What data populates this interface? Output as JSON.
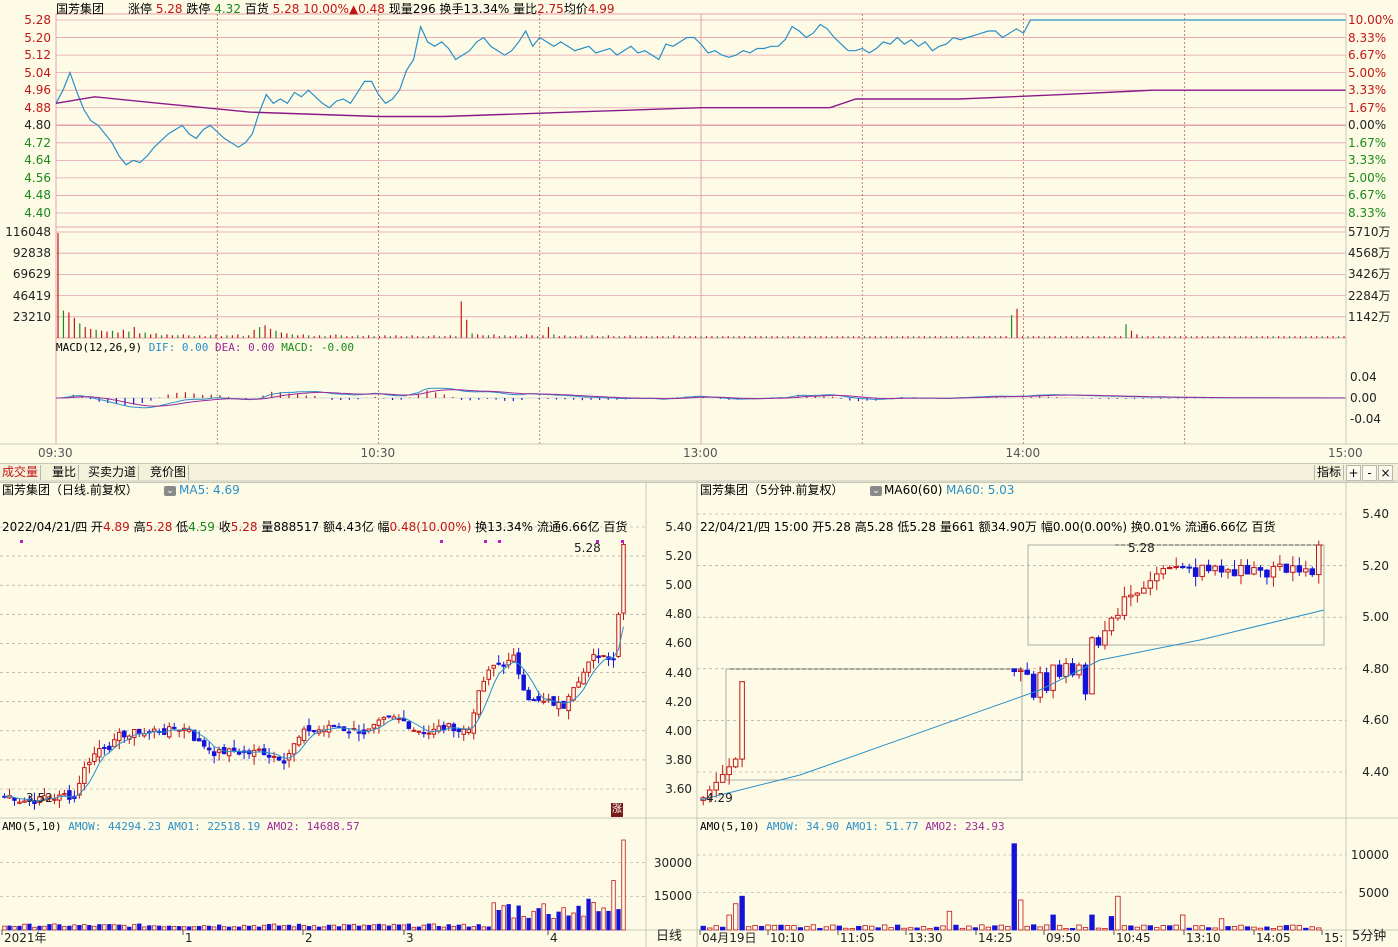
{
  "colors": {
    "up": "#c21515",
    "down": "#1414d8",
    "price_line": "#2a8fc8",
    "avg_line": "#8a1a8a",
    "dif": "#2a8fc8",
    "dea": "#9a2a9a",
    "grid": "#e6a0b0",
    "flat": "#222222",
    "neg": "#1a8a1a"
  },
  "intraday": {
    "header": {
      "name": "国芳集团",
      "limit_up_label": "涨停",
      "limit_up": "5.28",
      "limit_down_label": "跌停",
      "limit_down": "4.32",
      "pct_label": "百货",
      "price": "5.28",
      "pct": "10.00%",
      "change_arrow": "▲",
      "change": "0.48",
      "vol_now_label": "现量",
      "vol_now": "296",
      "turnover_label": "换手",
      "turnover": "13.34%",
      "vol_ratio_label": "量比",
      "vol_ratio": "2.75",
      "avg_label": "均价",
      "avg": "4.99"
    },
    "price_ticks": [
      "5.28",
      "5.20",
      "5.12",
      "5.04",
      "4.96",
      "4.88",
      "4.80",
      "4.72",
      "4.64",
      "4.56",
      "4.48",
      "4.40"
    ],
    "pct_ticks": [
      "10.00%",
      "8.33%",
      "6.67%",
      "5.00%",
      "3.33%",
      "1.67%",
      "0.00%",
      "1.67%",
      "3.33%",
      "5.00%",
      "6.67%",
      "8.33%"
    ],
    "vol_ticks_left": [
      "116048",
      "92838",
      "69629",
      "46419",
      "23210"
    ],
    "vol_ticks_right": [
      "5710万",
      "4568万",
      "3426万",
      "2284万",
      "1142万"
    ],
    "macd_label": "MACD(12,26,9)",
    "dif_label": "DIF: 0.00",
    "dea_label": "DEA: 0.00",
    "macd_val_label": "MACD: -0.00",
    "macd_ticks": [
      "0.04",
      "0.00",
      "-0.04"
    ],
    "time_ticks": [
      "09:30",
      "10:30",
      "13:00",
      "14:00",
      "15:00"
    ],
    "price_series": [
      4.9,
      4.96,
      5.04,
      4.95,
      4.87,
      4.82,
      4.8,
      4.76,
      4.72,
      4.66,
      4.62,
      4.64,
      4.63,
      4.66,
      4.7,
      4.73,
      4.76,
      4.78,
      4.8,
      4.76,
      4.74,
      4.78,
      4.8,
      4.77,
      4.74,
      4.72,
      4.7,
      4.72,
      4.76,
      4.86,
      4.94,
      4.9,
      4.92,
      4.9,
      4.95,
      4.93,
      4.96,
      4.93,
      4.9,
      4.88,
      4.91,
      4.92,
      4.9,
      4.95,
      5.0,
      5.0,
      4.94,
      4.9,
      4.92,
      4.96,
      5.05,
      5.1,
      5.25,
      5.18,
      5.16,
      5.18,
      5.15,
      5.1,
      5.12,
      5.14,
      5.18,
      5.2,
      5.16,
      5.14,
      5.12,
      5.14,
      5.18,
      5.23,
      5.16,
      5.2,
      5.18,
      5.16,
      5.18,
      5.16,
      5.14,
      5.15,
      5.16,
      5.13,
      5.14,
      5.15,
      5.12,
      5.14,
      5.16,
      5.13,
      5.14,
      5.12,
      5.1,
      5.17,
      5.16,
      5.18,
      5.2,
      5.2,
      5.17,
      5.13,
      5.14,
      5.12,
      5.11,
      5.12,
      5.14,
      5.13,
      5.15,
      5.15,
      5.16,
      5.16,
      5.19,
      5.25,
      5.23,
      5.2,
      5.22,
      5.26,
      5.24,
      5.2,
      5.17,
      5.14,
      5.14,
      5.15,
      5.13,
      5.15,
      5.18,
      5.17,
      5.2,
      5.17,
      5.19,
      5.16,
      5.18,
      5.14,
      5.16,
      5.17,
      5.2,
      5.19,
      5.2,
      5.21,
      5.22,
      5.23,
      5.23,
      5.2,
      5.22,
      5.24,
      5.22,
      5.28,
      5.28,
      5.28,
      5.28,
      5.28,
      5.28,
      5.28,
      5.28,
      5.28,
      5.28,
      5.28,
      5.28,
      5.28,
      5.28,
      5.28,
      5.28,
      5.28,
      5.28,
      5.28,
      5.28,
      5.28,
      5.28,
      5.28,
      5.28,
      5.28,
      5.28,
      5.28,
      5.28,
      5.28,
      5.28,
      5.28,
      5.28,
      5.28,
      5.28,
      5.28,
      5.28,
      5.28,
      5.28,
      5.28,
      5.28,
      5.28,
      5.28,
      5.28,
      5.28,
      5.28,
      5.28
    ],
    "avg_series": [
      [
        0,
        4.9
      ],
      [
        0.03,
        4.93
      ],
      [
        0.08,
        4.9
      ],
      [
        0.15,
        4.86
      ],
      [
        0.25,
        4.84
      ],
      [
        0.3,
        4.84
      ],
      [
        0.4,
        4.86
      ],
      [
        0.5,
        4.88
      ],
      [
        0.6,
        4.88
      ],
      [
        0.62,
        4.92
      ],
      [
        0.7,
        4.92
      ],
      [
        0.78,
        4.94
      ],
      [
        0.85,
        4.96
      ],
      [
        0.95,
        4.96
      ],
      [
        1,
        4.96
      ]
    ],
    "volume_bars": [
      115000,
      30000,
      28000,
      22000,
      16000,
      12000,
      10000,
      9000,
      8000,
      7000,
      8000,
      6000,
      9000,
      7000,
      12000,
      5000,
      6000,
      4000,
      5000,
      3000,
      4000,
      3000,
      3000,
      4000,
      3000,
      2000,
      3000,
      2000,
      3000,
      4000,
      2000,
      3000,
      3000,
      4000,
      2000,
      3000,
      9000,
      12000,
      14000,
      10000,
      8000,
      6000,
      5000,
      4000,
      3000,
      4000,
      3000,
      2000,
      3000,
      2000,
      3000,
      4000,
      3000,
      2000,
      2000,
      3000,
      2000,
      3000,
      2000,
      2000,
      3000,
      2000,
      3000,
      2000,
      2000,
      3000,
      2000,
      2000,
      2000,
      3000,
      2000,
      2000,
      3000,
      2000,
      40000,
      20000,
      5000,
      4000,
      3000,
      3000,
      4000,
      2000,
      3000,
      2000,
      3000,
      2000,
      4000,
      3000,
      2000,
      3000,
      12000,
      4000,
      2000,
      3000,
      2000,
      2000,
      3000,
      2000,
      3000,
      2000,
      2000,
      3000,
      2000,
      2000,
      2000,
      3000,
      2000,
      2000,
      2000,
      2000,
      2000,
      2000,
      2000,
      3000,
      2000,
      2000,
      2000,
      2000,
      2000,
      2000,
      2000,
      2000,
      2000,
      2000,
      2000,
      2000,
      2000,
      2000,
      2000,
      2000,
      2000,
      2000,
      2000,
      2000,
      2000,
      2000,
      2000,
      2000,
      2000,
      2000,
      2000,
      2000,
      2000,
      2000,
      2000,
      2000,
      2000,
      2000,
      2000,
      2000,
      2000,
      2000,
      2000,
      2000,
      2000,
      2000,
      2000,
      2000,
      2000,
      2000,
      2000,
      2000,
      2000,
      2000,
      2000,
      2000,
      2000,
      2000,
      2000,
      2000,
      2000,
      2000,
      2000,
      2000,
      2000,
      25000,
      32000,
      2000,
      2000,
      2000,
      2000,
      2000,
      2000,
      2000,
      2000,
      2000,
      2000,
      2000,
      2000,
      2000,
      2000,
      2000,
      2000,
      2000,
      2000,
      2000,
      15000,
      8000,
      4000,
      2000,
      2000,
      2000,
      2000,
      2000,
      2000,
      2000,
      2000,
      2000,
      2000,
      2000,
      2000,
      2000,
      2000,
      2000,
      2000,
      2000,
      2000,
      2000,
      2000,
      2000,
      2000,
      2000,
      2000,
      2000,
      2000,
      2000,
      2000,
      2000,
      2000,
      2000,
      2000,
      2000,
      2000,
      2000,
      2000,
      2000,
      2000
    ]
  },
  "tabs": [
    "成交量",
    "量比",
    "买卖力道",
    "竞价图"
  ],
  "toolbar": {
    "indicator": "指标",
    "plus": "+",
    "minus": "-",
    "close": "×"
  },
  "daily": {
    "title": "国芳集团（日线.前复权）",
    "ma_label": "MA5: 4.69",
    "info_date": "2022/04/21/四",
    "open_label": "开",
    "open": "4.89",
    "high_label": "高",
    "high": "5.28",
    "low_label": "低",
    "low": "4.59",
    "close_label": "收",
    "close": "5.28",
    "vol_label": "量",
    "vol": "888517",
    "amt_label": "额",
    "amt": "4.43亿",
    "chg_label": "幅",
    "chg": "0.48(10.00%)",
    "turn_label": "换",
    "turn": "13.34%",
    "float_label": "流通",
    "float": "6.66亿",
    "pct_label": "百货",
    "price_ticks": [
      "5.40",
      "5.20",
      "5.00",
      "4.80",
      "4.60",
      "4.40",
      "4.20",
      "4.00",
      "3.80",
      "3.60"
    ],
    "max_label": "5.28",
    "min_label": "3.52",
    "limit_mark": "涨",
    "amo_label": "AMO(5,10)",
    "amow_label": "AMOW: 44294.23",
    "amo1_label": "AMO1: 22518.19",
    "amo2_label": "AMO2: 14688.57",
    "amo_ticks": [
      "30000",
      "15000"
    ],
    "x_ticks": [
      "2021年",
      "1",
      "2",
      "3",
      "4"
    ],
    "period_label": "日线"
  },
  "m5": {
    "title": "国芳集团（5分钟.前复权）",
    "ma_label": "MA60(60)",
    "ma60_label": "MA60: 5.03",
    "info_date": "22/04/21/四",
    "time": "15:00",
    "open_label": "开",
    "open": "5.28",
    "high_label": "高",
    "high": "5.28",
    "low_label": "低",
    "low": "5.28",
    "vol_label": "量",
    "vol": "661",
    "amt_label": "额",
    "amt": "34.90万",
    "chg_label": "幅",
    "chg": "0.00(0.00%)",
    "turn_label": "换",
    "turn": "0.01%",
    "float_label": "流通",
    "float": "6.66亿",
    "pct_label": "百货",
    "price_ticks": [
      "5.40",
      "5.20",
      "5.00",
      "4.80",
      "4.60",
      "4.40"
    ],
    "max_label": "5.28",
    "min_label": "4.29",
    "amo_label": "AMO(5,10)",
    "amow_label": "AMOW: 34.90",
    "amo1_label": "AMO1: 51.77",
    "amo2_label": "AMO2: 234.93",
    "amo_ticks": [
      "10000",
      "5000"
    ],
    "x_ticks": [
      "04月19日",
      "10:10",
      "11:05",
      "13:30",
      "14:25",
      "09:50",
      "10:45",
      "13:10",
      "14:05",
      "15:"
    ],
    "period_label": "5分钟"
  }
}
